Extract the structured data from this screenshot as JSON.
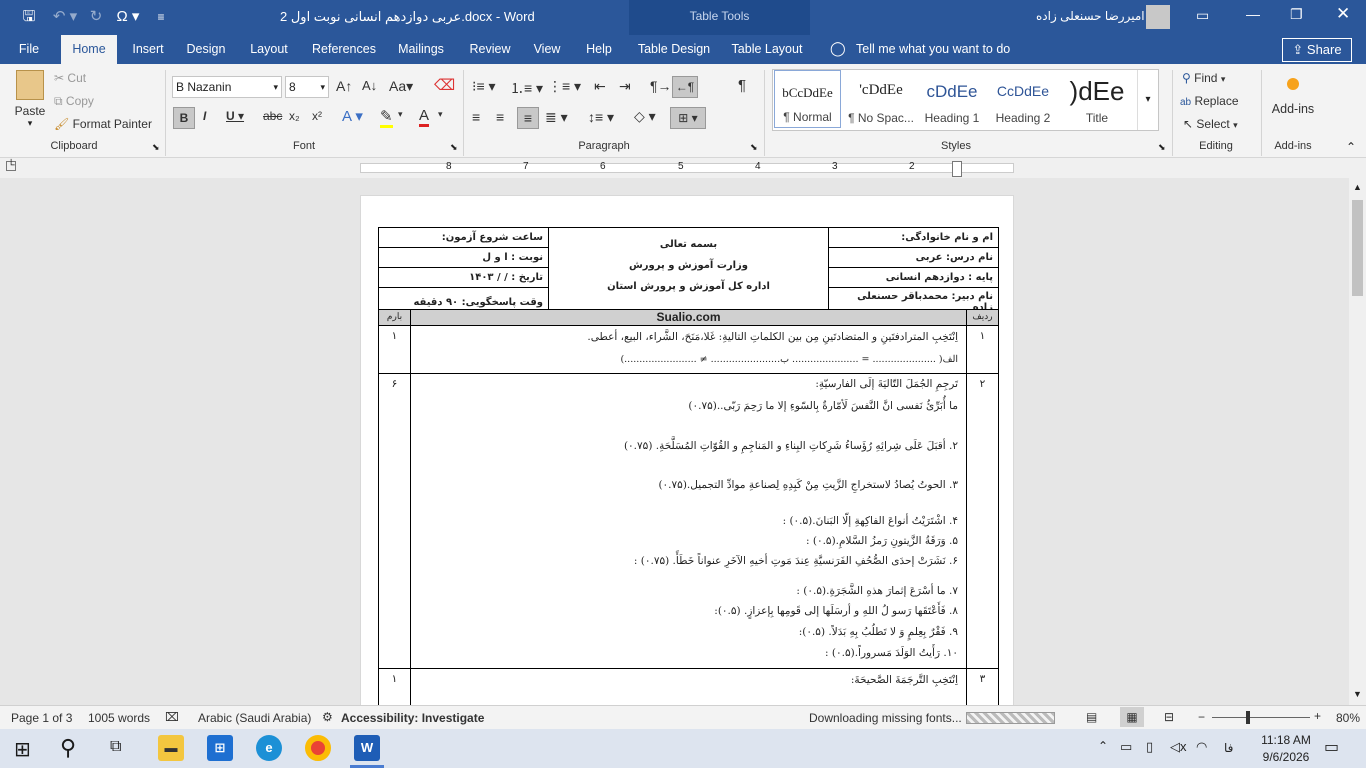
{
  "window": {
    "title": "عربی دوازدهم انسانی نوبت اول 2.docx  -  Word",
    "table_tools": "Table Tools",
    "user": "امیررضا حسنعلی زاده"
  },
  "tabs": [
    "File",
    "Home",
    "Insert",
    "Design",
    "Layout",
    "References",
    "Mailings",
    "Review",
    "View",
    "Help",
    "Table Design",
    "Table Layout"
  ],
  "tell_me": "Tell me what you want to do",
  "share": "Share",
  "clipboard": {
    "paste": "Paste",
    "cut": "Cut",
    "copy": "Copy",
    "format_painter": "Format Painter",
    "group": "Clipboard"
  },
  "font": {
    "name": "B Nazanin",
    "size": "8",
    "group": "Font"
  },
  "paragraph": {
    "group": "Paragraph"
  },
  "styles": {
    "group": "Styles",
    "items": [
      {
        "preview": "bCcDdEe",
        "label": "¶ Normal"
      },
      {
        "preview": "'cDdEe",
        "label": "¶ No Spac..."
      },
      {
        "preview": "cDdEe",
        "label": "Heading 1"
      },
      {
        "preview": "CcDdEe",
        "label": "Heading 2"
      },
      {
        "preview": ")dEe",
        "label": "Title"
      }
    ]
  },
  "editing": {
    "find": "Find",
    "replace": "Replace",
    "select": "Select",
    "group": "Editing"
  },
  "addins": {
    "label": "Add-ins",
    "group": "Add-ins"
  },
  "ruler": {
    "numbers": [
      "8",
      "7",
      "6",
      "5",
      "4",
      "3",
      "2",
      "1"
    ]
  },
  "doc": {
    "header": {
      "name": "ام و نام خانوادگی:",
      "lesson": "نام درس: عربی",
      "grade": "پایه : دوازدهم انسانی",
      "teacher": "نام دبیر: محمدباقر حسنعلی زاده",
      "center1": "بسمه تعالی",
      "center2": "وزارت آموزش و پرورش",
      "center3": "اداره کل آموزش و پرورش استان",
      "start": "ساعت شروع آزمون:",
      "session": "نوبت   :   ا و ل",
      "date": "تاریخ   :    /    /   ۱۴۰۳",
      "duration": "وقت پاسخگویی: ۹۰ دقیقه",
      "radif": "ردیف",
      "site": "Sualio.com",
      "barem": "بارم"
    },
    "q1": {
      "num": "۱",
      "score": "۱",
      "line1": "اِنْتَخِبِ المترادفتَینِ و المتضادتَینِ مِن بین الکلماتِ التالیةِ:       غَلا،مَنَحَ، الشَّراء، البیع، أعطی.",
      "line2": "الف( ..................... = ......................         ب....................... ≠ ........................)"
    },
    "q2": {
      "num": "۲",
      "score": "۶",
      "lines": [
        "تَرجِمِ الجُمَلَ التّالیَةَ إلَی الفارسیّةِ:",
        "ما أُبَرِّئُ نَفسی انَّ النَّفسَ لَأمّارةٌ بِالسّوءِ إلا ما رَحِمَ رَبّی..(۰.۷۵)",
        "۲. أقبَلَ عَلَی شِرائِهِ رُؤَساءُ شَرِکاتِ البِناءِ و المَناجِمِ و القُوّاتِ المُسَلَّحَةِ. (۰.۷۵)",
        "۳. الحوتُ یُصادُ لاستخراجِ الزَّیتِ مِنْ کَبِدِهِ لِصناعةِ موادِّ التجمیل.(۰.۷۵)",
        "۴. اشْتَرَیْتُ أنواعَ الفاکِهةِ إلّا البَنانَ.(۰.۵) :",
        "۵. وَرَقَةُ الزَّیتونِ رَمزُ السَّلامِ.(۰.۵) :",
        "۶. نَشَرَتْ إحدَی الصُّحُفِ الفَرَنسیَّةِ عِندَ مَوتِ أخیهِ الآخَرِ عنواناً خَطَأً. (۰.۷۵) :",
        "۷. ما أسْرَعَ إثمارَ هذهِ الشَّجَرَةِ.(۰.۵) :",
        "۸. فَأَعْتَقَها رَسو لُ اللهِ و أرسَلَها إلی قَومِها بِإعزازٍ. (۰.۵):",
        "۹. فَقْرٌ بِعِلمٍ وَ لا تَطلُبُ بِهِ بَدَلاً. (۰.۵):",
        "۱۰. رَأَیتُ الوَلَدَ مَسروراً.(۰.۵) :"
      ]
    },
    "q3": {
      "num": "۳",
      "score": "۱",
      "line1": "اِنْتَخِبِ التَّرجَمَةَ الصَّحیحَةَ:"
    }
  },
  "status": {
    "page": "Page 1 of 3",
    "words": "1005 words",
    "language": "Arabic (Saudi Arabia)",
    "accessibility": "Accessibility: Investigate",
    "downloading": "Downloading missing fonts...",
    "zoom": "80%"
  },
  "taskbar": {
    "time": "11:18 AM",
    "date": "9/6/2026",
    "lang": "فا"
  }
}
